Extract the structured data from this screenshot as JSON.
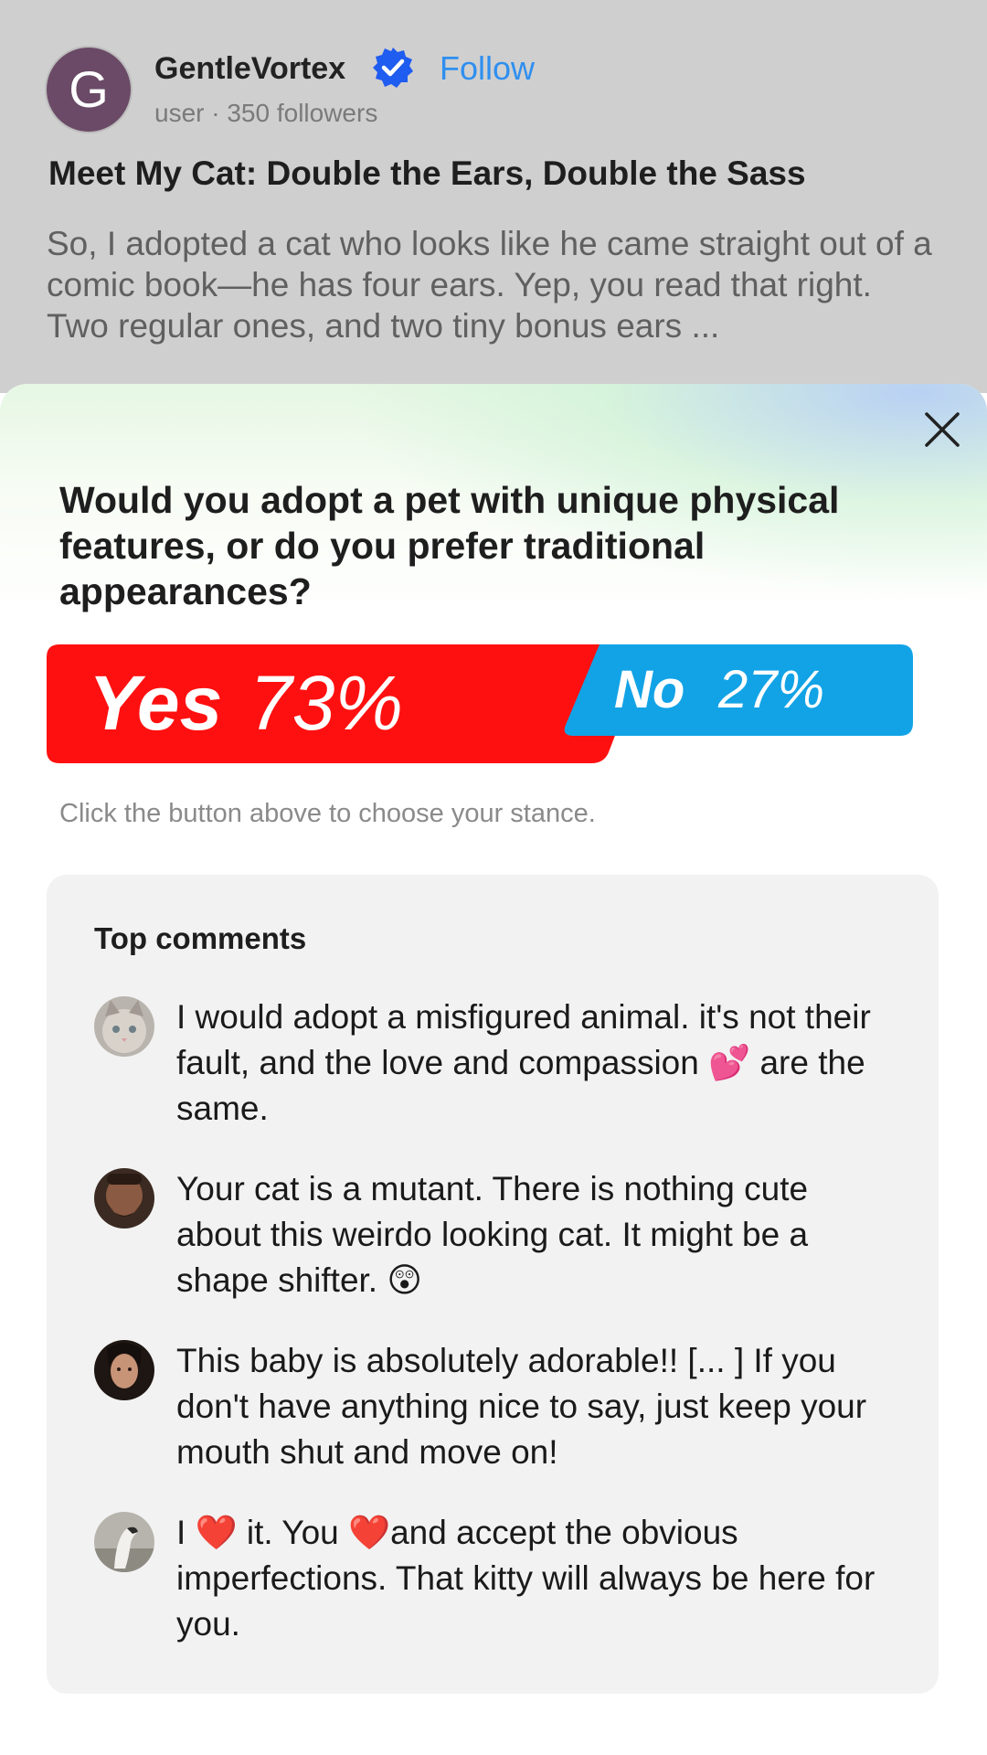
{
  "post": {
    "author": {
      "avatar_letter": "G",
      "name": "GentleVortex",
      "verified_icon": "verified-badge-icon",
      "follow_label": "Follow",
      "meta": "user · 350 followers"
    },
    "title": "Meet My Cat: Double the Ears, Double the Sass",
    "excerpt": "So, I adopted a cat who looks like he came straight out of a comic book—he has four ears. Yep, you read that right. Two regular ones, and two tiny bonus ears ..."
  },
  "poll": {
    "close_icon": "close-icon",
    "question": "Would you adopt a pet with unique physical features, or do you prefer traditional appearances?",
    "yes": {
      "label": "Yes",
      "percent": "73%",
      "color": "#ff1010"
    },
    "no": {
      "label": "No",
      "percent": "27%",
      "color": "#12a3e6"
    },
    "hint": "Click the button above to choose your stance."
  },
  "comments": {
    "heading": "Top comments",
    "items": [
      {
        "avatar": "cat-avatar",
        "text_before": "I would adopt a misfigured animal.  it's not their fault, and the love and compassion ",
        "emoji": "💕",
        "text_after": " are the same."
      },
      {
        "avatar": "bearded-man-avatar",
        "text_before": "Your cat is a mutant.  There is nothing cute about this weirdo looking cat.  It might be a shape shifter.  ",
        "emoji": "😲",
        "text_after": ""
      },
      {
        "avatar": "woman-avatar",
        "text_before": "This baby is absolutely adorable!!  [... ] If you don't have anything nice to say, just keep your mouth shut and move on!",
        "emoji": "",
        "text_after": ""
      },
      {
        "avatar": "bird-avatar",
        "text_1": "I ",
        "emoji_1": "❤️",
        "text_2": " it.  You ",
        "emoji_2": "❤️",
        "text_3": "and accept the obvious imperfections.  That kitty will always be here for you."
      }
    ]
  }
}
